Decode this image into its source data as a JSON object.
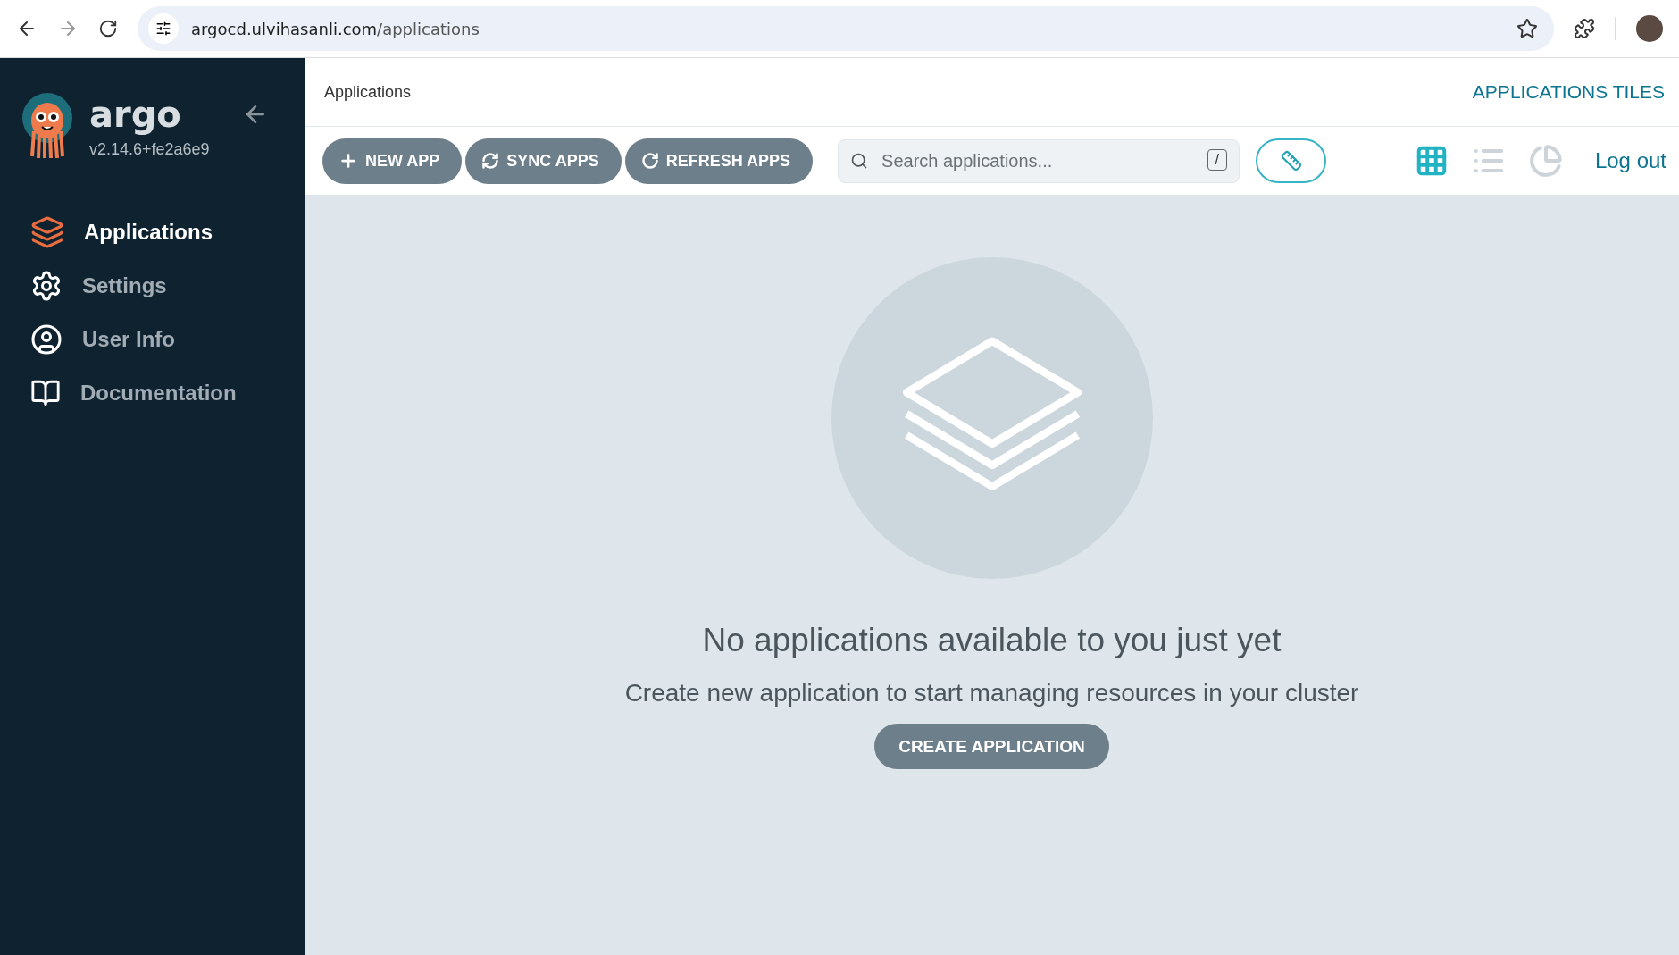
{
  "browser": {
    "url_host": "argocd.ulvihasanli.com",
    "url_path": "/applications"
  },
  "sidebar": {
    "logo_text": "argo",
    "version": "v2.14.6+fe2a6e9",
    "items": [
      {
        "kind": "applications",
        "label": "Applications",
        "selected": true
      },
      {
        "kind": "settings",
        "label": "Settings",
        "selected": false
      },
      {
        "kind": "user",
        "label": "User Info",
        "selected": false
      },
      {
        "kind": "docs",
        "label": "Documentation",
        "selected": false
      }
    ]
  },
  "header": {
    "title": "Applications",
    "view_title": "APPLICATIONS TILES"
  },
  "toolbar": {
    "buttons": [
      {
        "kind": "new",
        "label": "NEW APP"
      },
      {
        "kind": "sync",
        "label": "SYNC APPS"
      },
      {
        "kind": "refresh",
        "label": "REFRESH APPS"
      }
    ],
    "search": {
      "placeholder": "Search applications...",
      "shortcut": "/"
    },
    "views": [
      {
        "kind": "tiles",
        "selected": true
      },
      {
        "kind": "list",
        "selected": false
      },
      {
        "kind": "summary",
        "selected": false
      }
    ],
    "logout": "Log out"
  },
  "empty_state": {
    "title": "No applications available to you just yet",
    "subtitle": "Create new application to start managing resources in your cluster",
    "button": "CREATE APPLICATION"
  }
}
